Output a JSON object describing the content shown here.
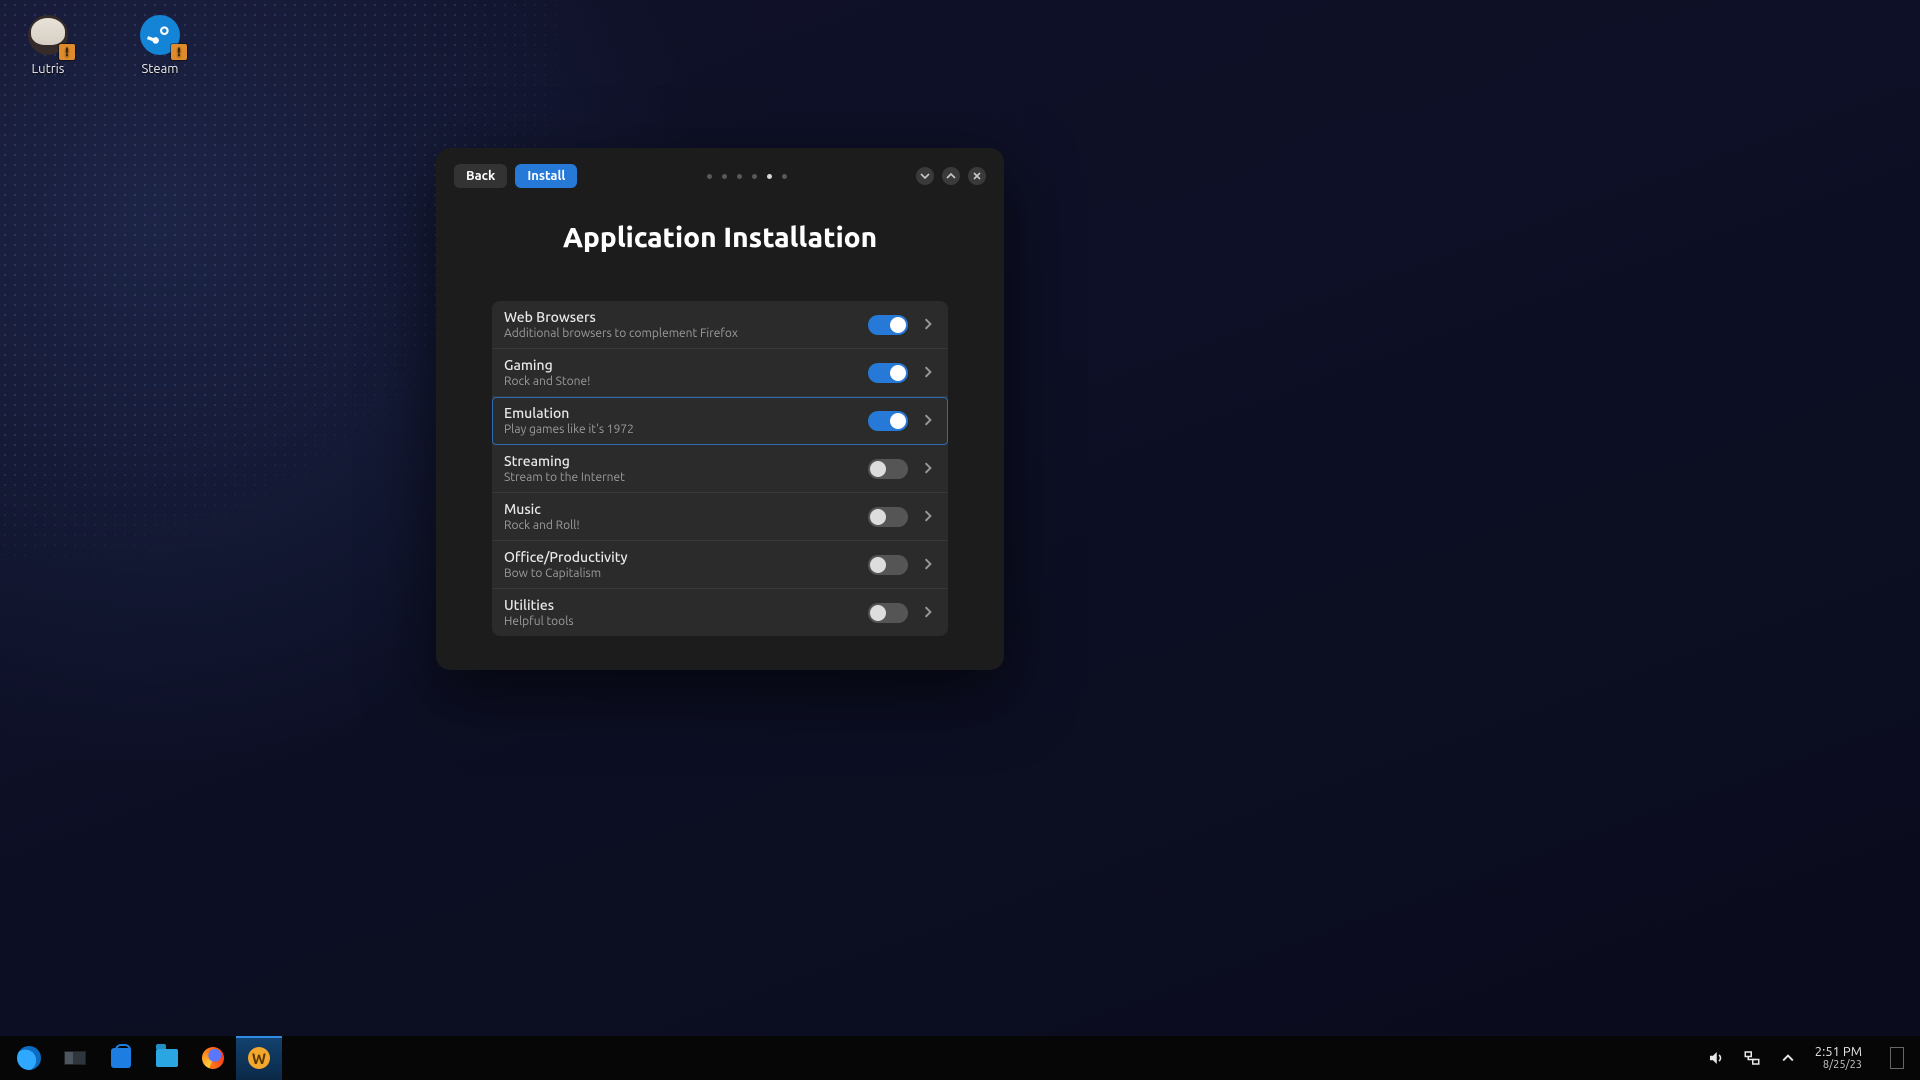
{
  "desktop_icons": [
    {
      "name": "lutris",
      "label": "Lutris"
    },
    {
      "name": "steam",
      "label": "Steam"
    }
  ],
  "dialog": {
    "back_label": "Back",
    "install_label": "Install",
    "page_dots": {
      "total": 6,
      "active_index": 4
    },
    "title": "Application Installation",
    "selected_index": 2,
    "categories": [
      {
        "title": "Web Browsers",
        "subtitle": "Additional browsers to complement Firefox",
        "enabled": true
      },
      {
        "title": "Gaming",
        "subtitle": "Rock and Stone!",
        "enabled": true
      },
      {
        "title": "Emulation",
        "subtitle": "Play games like it's 1972",
        "enabled": true
      },
      {
        "title": "Streaming",
        "subtitle": "Stream to the Internet",
        "enabled": false
      },
      {
        "title": "Music",
        "subtitle": "Rock and Roll!",
        "enabled": false
      },
      {
        "title": "Office/Productivity",
        "subtitle": "Bow to Capitalism",
        "enabled": false
      },
      {
        "title": "Utilities",
        "subtitle": "Helpful tools",
        "enabled": false
      }
    ]
  },
  "taskbar": {
    "items": [
      {
        "name": "start",
        "active": false
      },
      {
        "name": "settings",
        "active": false
      },
      {
        "name": "store",
        "active": false
      },
      {
        "name": "files",
        "active": false
      },
      {
        "name": "firefox",
        "active": false
      },
      {
        "name": "installer",
        "active": true
      }
    ],
    "clock_time": "2:51 PM",
    "clock_date": "8/25/23"
  }
}
